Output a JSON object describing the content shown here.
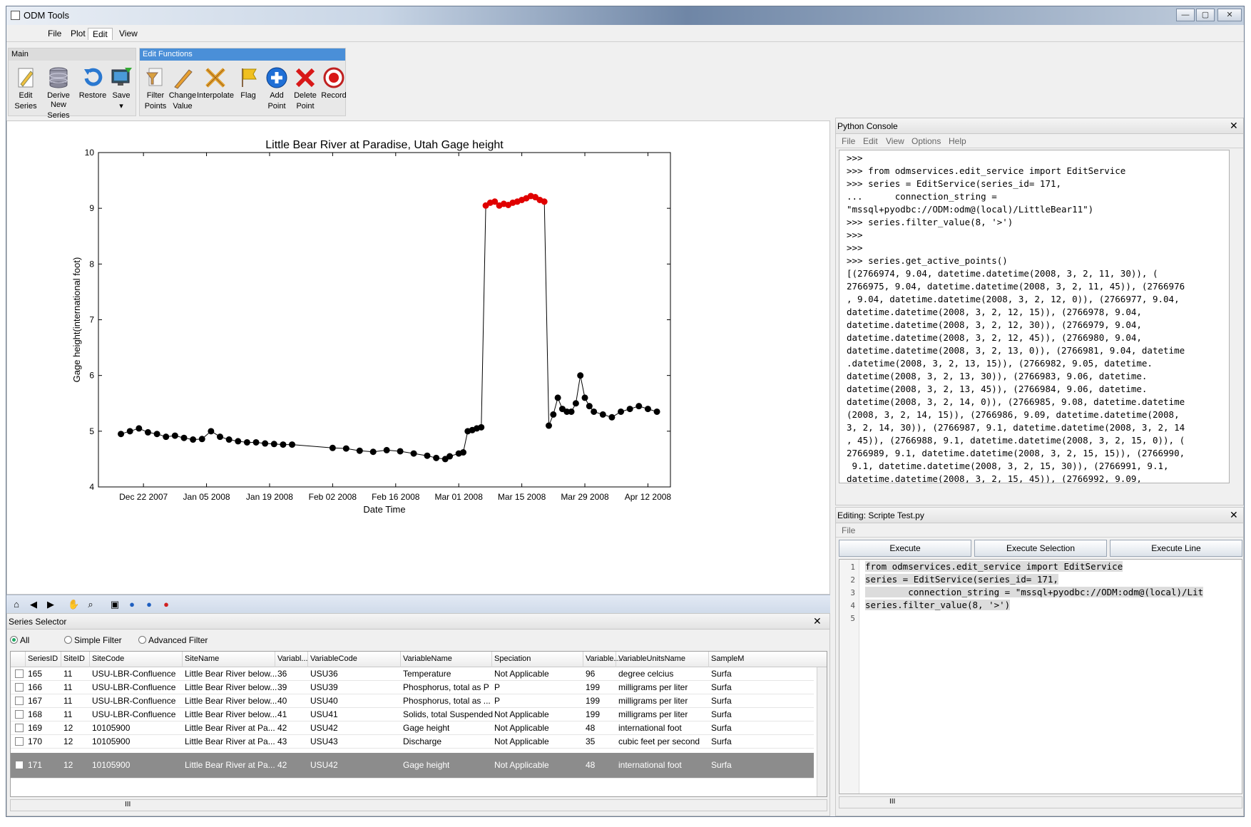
{
  "window": {
    "title": "ODM Tools",
    "controls": [
      "—",
      "▢",
      "✕"
    ]
  },
  "menu": [
    "File",
    "Plot",
    "Edit",
    "View"
  ],
  "ribbon": {
    "main": {
      "title": "Main",
      "buttons": [
        {
          "label1": "Edit",
          "label2": "Series",
          "icon": "pencil-document-icon"
        },
        {
          "label1": "Derive New",
          "label2": "Series",
          "icon": "database-icon"
        },
        {
          "label1": "Restore",
          "label2": "",
          "icon": "restore-arrow-icon"
        },
        {
          "label1": "Save",
          "label2": "▾",
          "icon": "save-monitor-icon"
        }
      ]
    },
    "edit": {
      "title": "Edit Functions",
      "buttons": [
        {
          "label1": "Filter",
          "label2": "Points",
          "icon": "filter-icon"
        },
        {
          "label1": "Change",
          "label2": "Value",
          "icon": "pencil-icon"
        },
        {
          "label1": "Interpolate",
          "label2": "",
          "icon": "interpolate-icon"
        },
        {
          "label1": "Flag",
          "label2": "",
          "icon": "flag-icon"
        },
        {
          "label1": "Add",
          "label2": "Point",
          "icon": "add-icon"
        },
        {
          "label1": "Delete",
          "label2": "Point",
          "icon": "delete-icon"
        },
        {
          "label1": "Record",
          "label2": "",
          "icon": "record-icon"
        }
      ]
    }
  },
  "chart_data": {
    "type": "scatter",
    "title": "Little Bear River at Paradise, Utah Gage height",
    "xlabel": "Date Time",
    "ylabel": "Gage height(international foot)",
    "ylim": [
      4,
      10
    ],
    "xlim": [
      "2007-12-12",
      "2008-04-17"
    ],
    "yticks": [
      4,
      5,
      6,
      7,
      8,
      9,
      10
    ],
    "xticks": [
      "Dec 22 2007",
      "Jan 05 2008",
      "Jan 19 2008",
      "Feb 02 2008",
      "Feb 16 2008",
      "Mar 01 2008",
      "Mar 15 2008",
      "Mar 29 2008",
      "Apr 12 2008"
    ],
    "series": [
      {
        "color": "#000000",
        "x": [
          "2007-12-17",
          "2007-12-19",
          "2007-12-21",
          "2007-12-23",
          "2007-12-25",
          "2007-12-27",
          "2007-12-29",
          "2007-12-31",
          "2008-01-02",
          "2008-01-04",
          "2008-01-06",
          "2008-01-08",
          "2008-01-10",
          "2008-01-12",
          "2008-01-14",
          "2008-01-16",
          "2008-01-18",
          "2008-01-20",
          "2008-01-22",
          "2008-01-24",
          "2008-02-02",
          "2008-02-05",
          "2008-02-08",
          "2008-02-11",
          "2008-02-14",
          "2008-02-17",
          "2008-02-20",
          "2008-02-23",
          "2008-02-25",
          "2008-02-27",
          "2008-02-28",
          "2008-03-01",
          "2008-03-02",
          "2008-03-03",
          "2008-03-04",
          "2008-03-05",
          "2008-03-06",
          "2008-03-21",
          "2008-03-22",
          "2008-03-23",
          "2008-03-24",
          "2008-03-25",
          "2008-03-26",
          "2008-03-27",
          "2008-03-28",
          "2008-03-29",
          "2008-03-30",
          "2008-03-31",
          "2008-04-02",
          "2008-04-04",
          "2008-04-06",
          "2008-04-08",
          "2008-04-10",
          "2008-04-12",
          "2008-04-14"
        ],
        "y": [
          4.95,
          5.0,
          5.05,
          4.98,
          4.95,
          4.9,
          4.92,
          4.88,
          4.85,
          4.86,
          5.0,
          4.9,
          4.85,
          4.82,
          4.8,
          4.8,
          4.78,
          4.77,
          4.76,
          4.76,
          4.7,
          4.69,
          4.65,
          4.63,
          4.66,
          4.64,
          4.6,
          4.56,
          4.52,
          4.5,
          4.55,
          4.6,
          4.62,
          5.0,
          5.02,
          5.05,
          5.07,
          5.1,
          5.3,
          5.6,
          5.4,
          5.35,
          5.35,
          5.5,
          6.0,
          5.6,
          5.45,
          5.35,
          5.3,
          5.25,
          5.35,
          5.4,
          5.45,
          5.4,
          5.35
        ]
      },
      {
        "color": "#e00000",
        "x": [
          "2008-03-07",
          "2008-03-08",
          "2008-03-09",
          "2008-03-10",
          "2008-03-11",
          "2008-03-12",
          "2008-03-13",
          "2008-03-14",
          "2008-03-15",
          "2008-03-16",
          "2008-03-17",
          "2008-03-18",
          "2008-03-19",
          "2008-03-20"
        ],
        "y": [
          9.05,
          9.1,
          9.12,
          9.05,
          9.08,
          9.06,
          9.1,
          9.12,
          9.15,
          9.18,
          9.22,
          9.2,
          9.15,
          9.12
        ]
      }
    ]
  },
  "plot_toolbar": [
    "home-icon",
    "back-arrow-icon",
    "forward-arrow-icon",
    "pan-hand-icon",
    "zoom-icon",
    "save-icon",
    "globe-icon",
    "globe2-icon",
    "help-icon"
  ],
  "series_selector": {
    "title": "Series Selector",
    "filters": [
      "All",
      "Simple Filter",
      "Advanced Filter"
    ],
    "columns": [
      "SeriesID",
      "SiteID",
      "SiteCode",
      "SiteName",
      "Variabl...",
      "VariableCode",
      "VariableName",
      "Speciation",
      "Variable...",
      "VariableUnitsName",
      "SampleM"
    ],
    "rows": [
      [
        "165",
        "11",
        "USU-LBR-Confluence",
        "Little Bear River below...",
        "36",
        "USU36",
        "Temperature",
        "Not Applicable",
        "96",
        "degree celcius",
        "Surfa"
      ],
      [
        "166",
        "11",
        "USU-LBR-Confluence",
        "Little Bear River below...",
        "39",
        "USU39",
        "Phosphorus, total as P",
        "P",
        "199",
        "milligrams per liter",
        "Surfa"
      ],
      [
        "167",
        "11",
        "USU-LBR-Confluence",
        "Little Bear River below...",
        "40",
        "USU40",
        "Phosphorus, total as ...",
        "P",
        "199",
        "milligrams per liter",
        "Surfa"
      ],
      [
        "168",
        "11",
        "USU-LBR-Confluence",
        "Little Bear River below...",
        "41",
        "USU41",
        "Solids, total Suspended",
        "Not Applicable",
        "199",
        "milligrams per liter",
        "Surfa"
      ],
      [
        "169",
        "12",
        "10105900",
        "Little Bear River at Pa...",
        "42",
        "USU42",
        "Gage height",
        "Not Applicable",
        "48",
        "international foot",
        "Surfa"
      ],
      [
        "170",
        "12",
        "10105900",
        "Little Bear River at Pa...",
        "43",
        "USU43",
        "Discharge",
        "Not Applicable",
        "35",
        "cubic feet per second",
        "Surfa"
      ],
      [
        "171",
        "12",
        "10105900",
        "Little Bear River at Pa...",
        "42",
        "USU42",
        "Gage height",
        "Not Applicable",
        "48",
        "international foot",
        "Surfa"
      ]
    ],
    "scroll_label": "III"
  },
  "console": {
    "title": "Python Console",
    "menu": [
      "File",
      "Edit",
      "View",
      "Options",
      "Help"
    ],
    "lines": [
      ">>>",
      ">>> from odmservices.edit_service import EditService",
      ">>> series = EditService(series_id= 171,",
      "...      connection_string =",
      "\"mssql+pyodbc://ODM:odm@(local)/LittleBear11\")",
      ">>> series.filter_value(8, '>')",
      ">>>",
      ">>>",
      ">>> series.get_active_points()",
      "[(2766974, 9.04, datetime.datetime(2008, 3, 2, 11, 30)), (",
      "2766975, 9.04, datetime.datetime(2008, 3, 2, 11, 45)), (2766976",
      ", 9.04, datetime.datetime(2008, 3, 2, 12, 0)), (2766977, 9.04,",
      "datetime.datetime(2008, 3, 2, 12, 15)), (2766978, 9.04,",
      "datetime.datetime(2008, 3, 2, 12, 30)), (2766979, 9.04,",
      "datetime.datetime(2008, 3, 2, 12, 45)), (2766980, 9.04,",
      "datetime.datetime(2008, 3, 2, 13, 0)), (2766981, 9.04, datetime",
      ".datetime(2008, 3, 2, 13, 15)), (2766982, 9.05, datetime.",
      "datetime(2008, 3, 2, 13, 30)), (2766983, 9.06, datetime.",
      "datetime(2008, 3, 2, 13, 45)), (2766984, 9.06, datetime.",
      "datetime(2008, 3, 2, 14, 0)), (2766985, 9.08, datetime.datetime",
      "(2008, 3, 2, 14, 15)), (2766986, 9.09, datetime.datetime(2008,",
      "3, 2, 14, 30)), (2766987, 9.1, datetime.datetime(2008, 3, 2, 14",
      ", 45)), (2766988, 9.1, datetime.datetime(2008, 3, 2, 15, 0)), (",
      "2766989, 9.1, datetime.datetime(2008, 3, 2, 15, 15)), (2766990,",
      " 9.1, datetime.datetime(2008, 3, 2, 15, 30)), (2766991, 9.1,",
      "datetime.datetime(2008, 3, 2, 15, 45)), (2766992, 9.09,"
    ]
  },
  "editor": {
    "title": "Editing: Scripte Test.py",
    "menu": [
      "File"
    ],
    "buttons": [
      "Execute",
      "Execute Selection",
      "Execute Line"
    ],
    "lines": [
      {
        "num": "1",
        "text": "from odmservices.edit_service import EditService"
      },
      {
        "num": "2",
        "text": "series = EditService(series_id= 171,"
      },
      {
        "num": "3",
        "text": "        connection_string = \"mssql+pyodbc://ODM:odm@(local)/Lit"
      },
      {
        "num": "4",
        "text": "series.filter_value(8, '>')"
      },
      {
        "num": "5",
        "text": ""
      }
    ],
    "scroll_label": "III"
  }
}
